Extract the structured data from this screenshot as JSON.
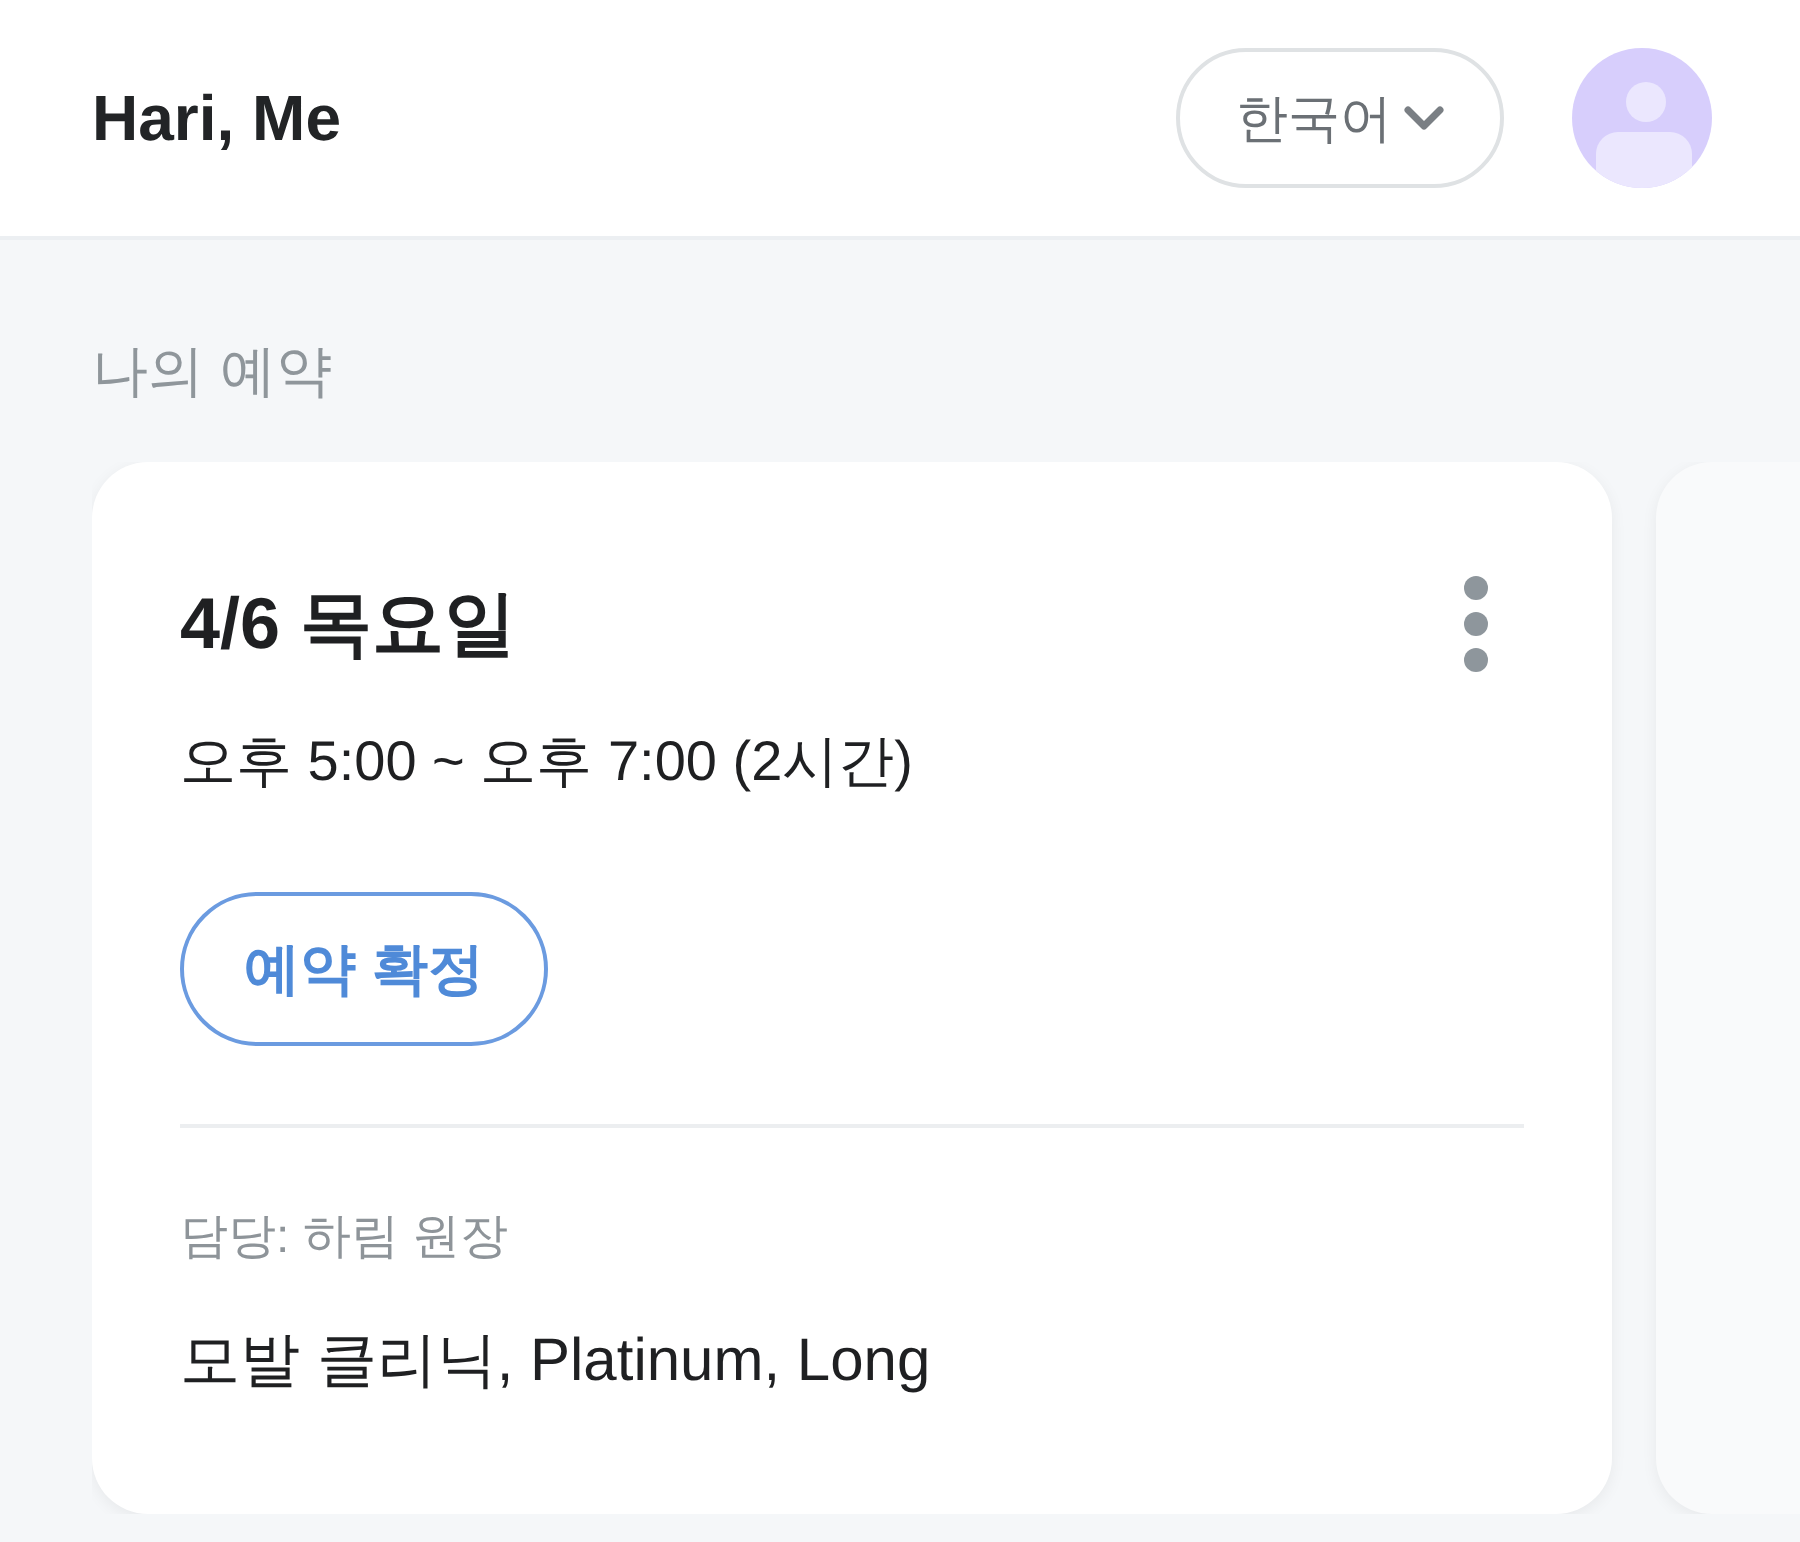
{
  "header": {
    "title": "Hari, Me",
    "language": "한국어"
  },
  "section_title": "나의 예약",
  "reservations": [
    {
      "date": "4/6 목요일",
      "time": "오후 5:00 ~ 오후 7:00 (2시간)",
      "status": "예약 확정",
      "staff": "담당: 하림 원장",
      "service": "모발 클리닉, Platinum, Long"
    }
  ]
}
